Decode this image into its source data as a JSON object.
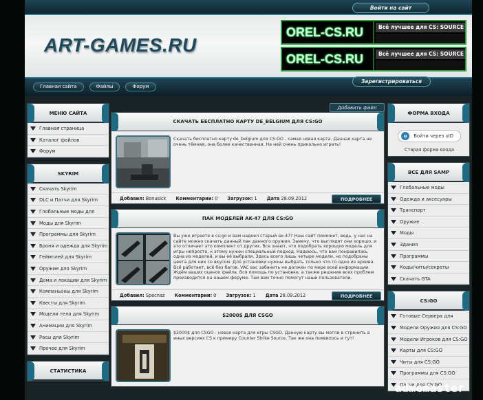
{
  "header": {
    "login_label": "Войти на сайт",
    "logo_text": "ART-GAMES.RU",
    "register_label": "Зарегистрироваться",
    "banners": [
      {
        "name": "OREL-CS.RU",
        "tagline": "Всё лучшее для CS: SOURCE"
      },
      {
        "name": "OREL-CS.RU",
        "tagline": "Всё лучшее для CS: SOURCE"
      }
    ],
    "nav": [
      "Главная сайта",
      "Файлы",
      "Форум"
    ]
  },
  "left": {
    "menu": {
      "title": "Меню сайта",
      "items": [
        "Главная страница",
        "Каталог файлов",
        "Форум"
      ]
    },
    "skyrim": {
      "title": "SKYRIM",
      "items": [
        "Скачать Skyrim",
        "DLC и Патчи для Skyrim",
        "Глобальные моды для",
        "Моды для Skyrim",
        "Программы для Skyrim",
        "Броня и одежда для Skyrim",
        "Геймплей для Skyrim",
        "Оружие для Skyrim",
        "Дома и локации для Skyrim",
        "Компаньоны для Skyrim",
        "Квесты для Skyrim",
        "Модели тела для Skyrim",
        "Анимации для Skyrim",
        "Расы для Skyrim",
        "Прочее для Skyrim"
      ]
    },
    "stats": {
      "title": "Статистика"
    }
  },
  "main": {
    "add_file_label": "Добавить файл",
    "more_label": "ПОДРОБНЕЕ",
    "meta_labels": {
      "added": "Добавил:",
      "comments": "Комментарии:",
      "downloads": "Загрузок:",
      "date": "Дата"
    },
    "articles": [
      {
        "title": "Скачать бесплатно карту de_belgium для CS:GO",
        "text": "Скачать бесплатно карту de_belgium для CS:GO - самая новая карта. Данная карта не очень тёмная, она более качественная. На ней очень прикольно играть!",
        "author": "Bonusick",
        "comments": "0",
        "downloads": "1",
        "date": "28.09.2012"
      },
      {
        "title": "Пак моделей AK-47 для CS:GO",
        "text": "Вы уже играете в cs:go и вам надоел старый ак-47? Наш сайт поможет, ведь, у нас на сайте можно скачать данный пак данного оружия. Замечу, что выглядят они хорошо, и это отличает это комплект от других. Все знают, что подобрать хорошую модель для игры непросто, к этому нужен специальный подход. Надеюсь, что вам понравилась одна из моделей, и вы её выбрали. Здесь всего лишь четыре модели, но подобраны цвета для них со вкусом. Для установки нужны выбрать только что-то одно из архива. Всё работает, всё без багов. VAC вас забанить не должен по мере всей информации. Ждём ваших оценок файла. Вся помощь по установке, а также решение всех проблем производится на нашем форуме. Там вам точно помогут наши пользователи.",
        "author": "Specnaz",
        "comments": "0",
        "downloads": "1",
        "date": "28.09.2012"
      },
      {
        "title": "$2000$ для CSGO",
        "text": "$2000$ для CSGO - новая карта для игры CSGO. Данную карту вы могли в стренить в иных версиях CS к примеру Counter Strike Source. Так же она появилось и тут!",
        "author": "",
        "comments": "",
        "downloads": "",
        "date": ""
      }
    ]
  },
  "right": {
    "login": {
      "title": "Форма входа",
      "uid_label": "Войти через uID",
      "old_form": "Старая форма входа"
    },
    "samp": {
      "title": "Все для SAMP",
      "items": [
        "Глобальные моды",
        "Одежда и аксесуары",
        "Транспорт",
        "Оружие",
        "Моды",
        "Здания",
        "Программы",
        "Коды/читы/секреты",
        "Скачать GTA"
      ]
    },
    "csgo": {
      "title": "CS:GO",
      "items": [
        "Готовые Сервера для",
        "Модели Оружия для CS:GO",
        "Модели Игроков для CS:GO",
        "Карты для CS:GO",
        "Читы для CS:GO",
        "Программы для CS:GO",
        "Патчи для CS:GO"
      ]
    }
  },
  "watermark": "admemaster"
}
